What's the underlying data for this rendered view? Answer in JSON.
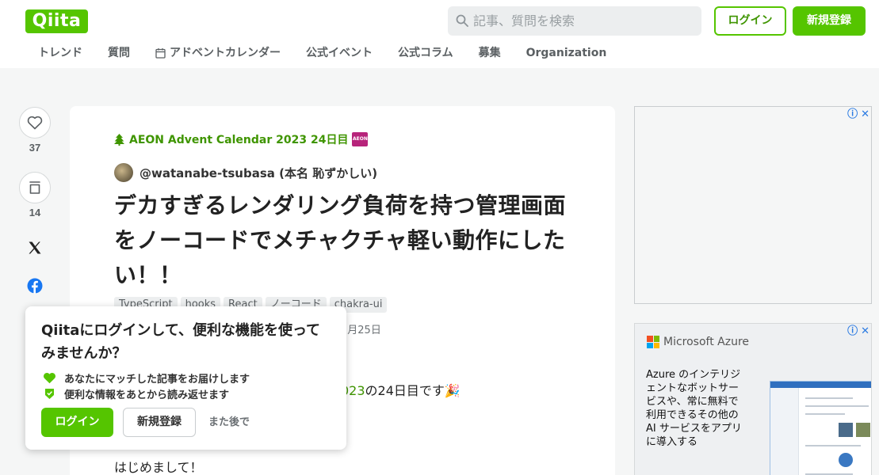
{
  "header": {
    "logo": "Qiita",
    "search_placeholder": "記事、質問を検索",
    "login_label": "ログイン",
    "signup_label": "新規登録",
    "nav": [
      "トレンド",
      "質問",
      "アドベントカレンダー",
      "公式イベント",
      "公式コラム",
      "募集",
      "Organization"
    ]
  },
  "actions": {
    "likes": "37",
    "stocks": "14"
  },
  "article": {
    "calendar": "AEON Advent Calendar 2023 24日目",
    "calendar_badge": "AEON",
    "author": "@watanabe-tsubasa (本名 恥ずかしい)",
    "title": "デカすぎるレンダリング負荷を持つ管理画面をノーコードでメチャクチャ軽い動作にしたい！！",
    "tags": [
      "TypeScript",
      "hooks",
      "React",
      "ノーコード",
      "chakra-ui"
    ],
    "date_visible": "2月25日",
    "intro_link_fragment": "023",
    "intro_rest": "の24日目です🎉",
    "greeting": "はじめまして！"
  },
  "popup": {
    "title": "Qiitaにログインして、便利な機能を使ってみませんか？",
    "benefits": [
      "あなたにマッチした記事をお届けします",
      "便利な情報をあとから読み返せます"
    ],
    "login_label": "ログイン",
    "signup_label": "新規登録",
    "later_label": "また後で"
  },
  "ads": {
    "info_icon": "ⓘ",
    "close_icon": "✕",
    "azure_brand": "Microsoft Azure",
    "azure_text": "Azure のインテリジェントなボットサービスや、常に無料で利用できるその他の AI サービスをアプリに導入する"
  },
  "colors": {
    "brand": "#55c500",
    "link": "#3f9500",
    "calendar_badge": "#b7247b"
  }
}
